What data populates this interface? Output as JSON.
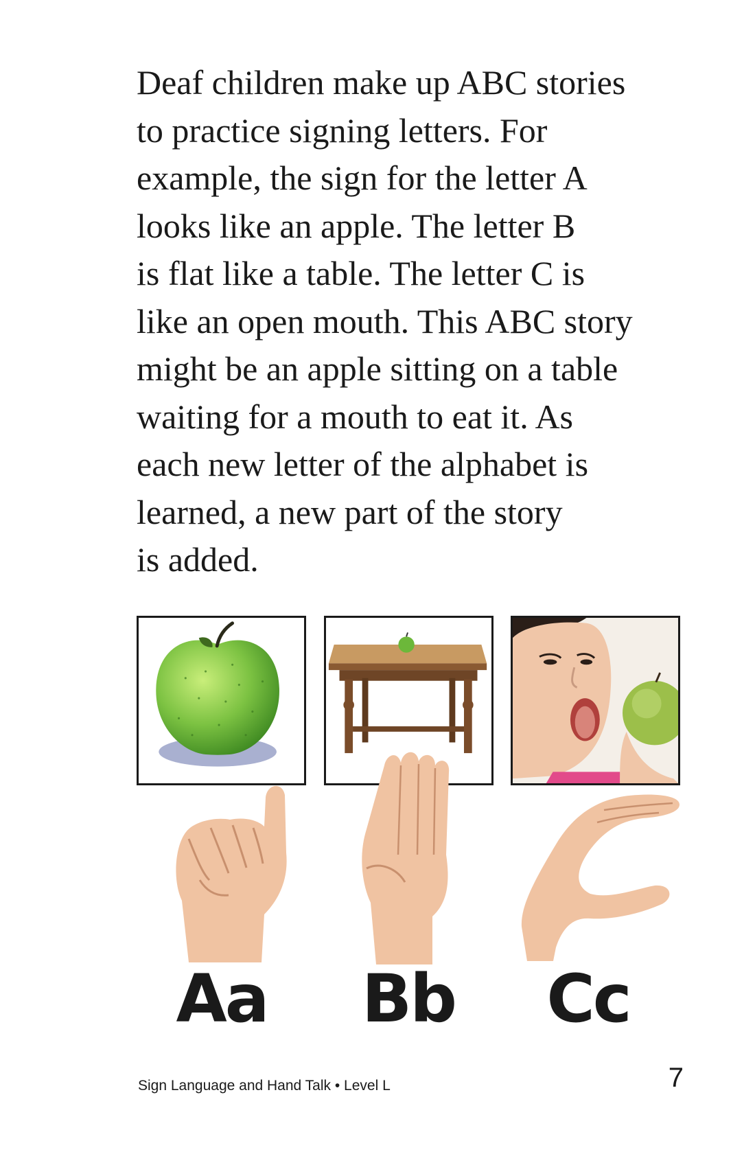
{
  "body_text": {
    "lines": [
      "Deaf children make up ABC stories",
      "to practice signing letters. For",
      "example, the sign for the letter A",
      "looks like an apple. The letter B",
      "is flat like a table. The letter C is",
      "like an open mouth. This ABC story",
      "might be an apple sitting on a table",
      "waiting for a mouth to eat it. As",
      "each new letter of the alphabet is",
      "learned, a new part of the story",
      "is added."
    ]
  },
  "illustrations": {
    "photos": [
      "apple",
      "table with apple",
      "girl with open mouth and apple"
    ],
    "hand_signs": [
      "A",
      "B",
      "C"
    ]
  },
  "letters": {
    "a": "Aa",
    "b": "Bb",
    "c": "Cc"
  },
  "footer": {
    "title": "Sign Language and Hand Talk • Level L",
    "page_number": "7"
  },
  "colors": {
    "text": "#1a1a1a",
    "apple_green": "#7cc242",
    "table_wood": "#8a5a32",
    "skin": "#f0c6a8"
  }
}
